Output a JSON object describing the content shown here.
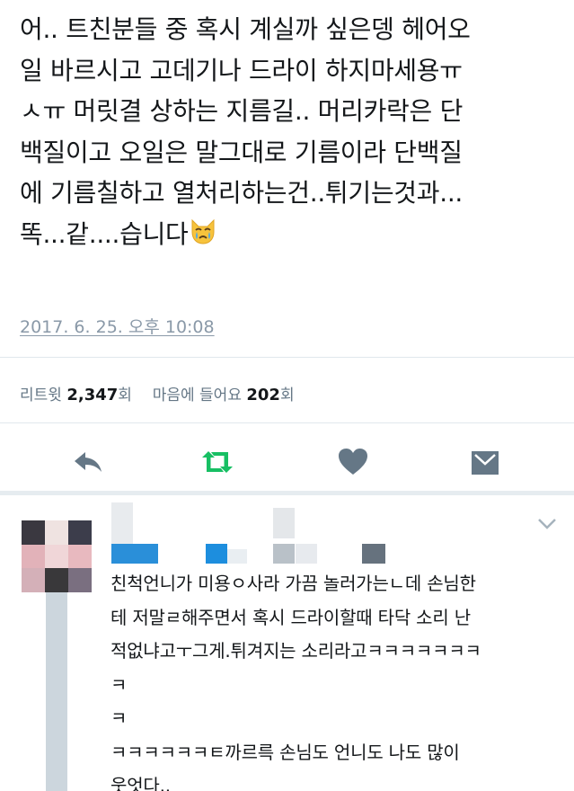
{
  "tweet": {
    "lines": [
      "어.. 트친분들 중 혹시 계실까 싶은뎅 헤어오",
      "일 바르시고 고데기나 드라이 하지마세용ㅠ",
      "ㅅㅠ 머릿결 상하는 지름길.. 머리카락은 단",
      "백질이고 오일은 말그대로 기름이라 단백질",
      "에 기름칠하고 열처리하는건..튀기는것과...",
      "똑...같....습니다"
    ],
    "emoji": "crying-cat-face",
    "timestamp": "2017. 6. 25. 오후 10:08"
  },
  "stats": {
    "retweet_label": "리트윗",
    "retweet_count": "2,347",
    "retweet_unit": "회",
    "like_label": "마음에 들어요",
    "like_count": "202",
    "like_unit": "회"
  },
  "actions": {
    "reply_icon": "reply-arrow-icon",
    "retweet_icon": "retweet-icon",
    "like_icon": "heart-icon",
    "message_icon": "envelope-icon",
    "retweet_color": "#17bf63",
    "icon_color": "#657786"
  },
  "reply": {
    "avatar_icon": "pixelated-avatar",
    "menu_icon": "chevron-down-icon",
    "lines": [
      "친척언니가 미용ㅇ사라 가끔 놀러가는ㄴ데 손님한",
      "테 저말ㄹ해주면서 혹시 드라이할때 타닥 소리 난",
      "적없냐고ㅜ그게.튀겨지는 소리라고ㅋㅋㅋㅋㅋㅋㅋ",
      "ㅋ",
      "ㅋ",
      "ㅋㅋㅋㅋㅋㅋㅌ까르륵 손님도 언니도 나도 많이",
      "웃엇다.."
    ]
  }
}
